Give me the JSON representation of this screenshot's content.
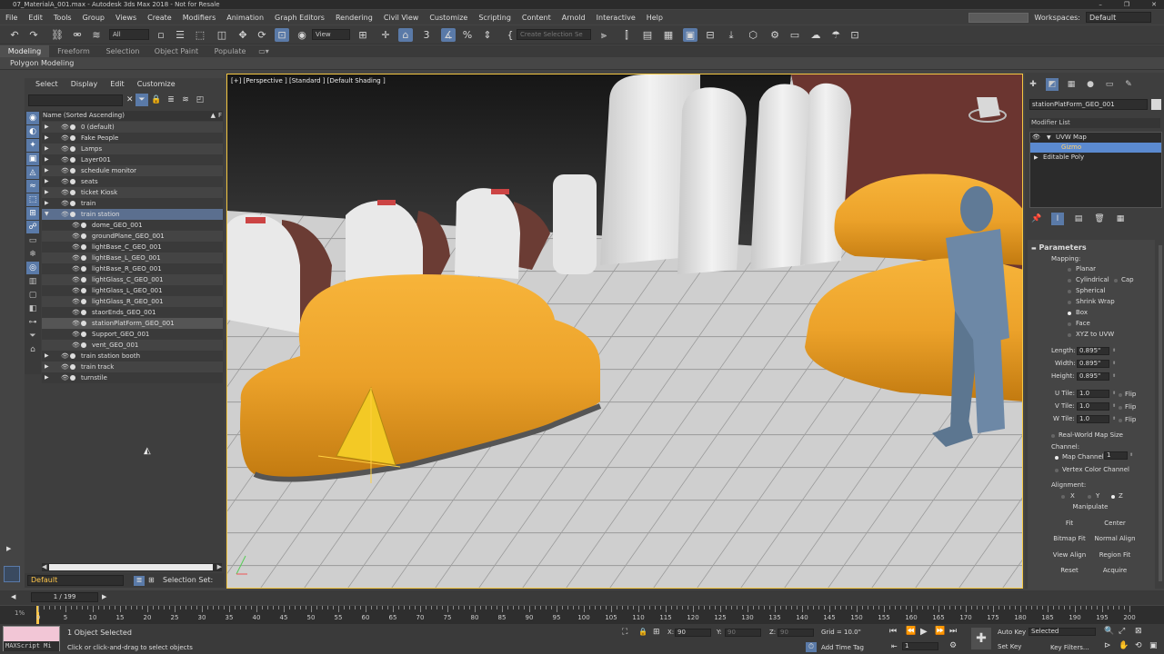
{
  "window": {
    "title": "07_MaterialA_001.max - Autodesk 3ds Max 2018 - Not for Resale"
  },
  "menu": [
    "File",
    "Edit",
    "Tools",
    "Group",
    "Views",
    "Create",
    "Modifiers",
    "Animation",
    "Graph Editors",
    "Rendering",
    "Civil View",
    "Customize",
    "Scripting",
    "Content",
    "Arnold",
    "Interactive",
    "Help"
  ],
  "workspace": {
    "label": "Workspaces:",
    "value": "Default"
  },
  "toolbar": {
    "filter_value": "All",
    "view_value": "View",
    "selection_set_placeholder": "Create Selection Se"
  },
  "ribbon": {
    "tabs": [
      "Modeling",
      "Freeform",
      "Selection",
      "Object Paint",
      "Populate"
    ],
    "subtitle": "Polygon Modeling"
  },
  "explorer": {
    "menu": [
      "Select",
      "Display",
      "Edit",
      "Customize"
    ],
    "header": "Name (Sorted Ascending)",
    "header_s": "▲",
    "header_f": "F",
    "rows": [
      {
        "label": "0 (default)"
      },
      {
        "label": "Fake People"
      },
      {
        "label": "Lamps"
      },
      {
        "label": "Layer001"
      },
      {
        "label": "schedule monitor"
      },
      {
        "label": "seats"
      },
      {
        "label": "ticket Kiosk"
      },
      {
        "label": "train"
      },
      {
        "label": "train station"
      },
      {
        "label": "dome_GEO_001"
      },
      {
        "label": "groundPlane_GEO_001"
      },
      {
        "label": "lightBase_C_GEO_001"
      },
      {
        "label": "lightBase_L_GEO_001"
      },
      {
        "label": "lightBase_R_GEO_001"
      },
      {
        "label": "lightGlass_C_GEO_001"
      },
      {
        "label": "lightGlass_L_GEO_001"
      },
      {
        "label": "lightGlass_R_GEO_001"
      },
      {
        "label": "staorEnds_GEO_001"
      },
      {
        "label": "stationPlatForm_GEO_001"
      },
      {
        "label": "Support_GEO_001"
      },
      {
        "label": "vent_GEO_001"
      },
      {
        "label": "train station booth"
      },
      {
        "label": "train track"
      },
      {
        "label": "turnstile"
      }
    ],
    "layer": "Default",
    "selection_set_label": "Selection Set:"
  },
  "viewport": {
    "label": "[+] [Perspective ] [Standard ] [Default Shading ]"
  },
  "command_panel": {
    "object_name": "stationPlatForm_GEO_001",
    "modifier_list": "Modifier List",
    "stack": [
      "UVW Map",
      "Gizmo",
      "Editable Poly"
    ],
    "parameters": {
      "title": "Parameters",
      "mapping_label": "Mapping:",
      "options": [
        "Planar",
        "Cylindrical",
        "Spherical",
        "Shrink Wrap",
        "Box",
        "Face",
        "XYZ to UVW"
      ],
      "cap": "Cap",
      "length_label": "Length:",
      "length": "0.895\"",
      "width_label": "Width:",
      "width": "0.895\"",
      "height_label": "Height:",
      "height": "0.895\"",
      "utile_label": "U Tile:",
      "utile": "1.0",
      "vtile_label": "V Tile:",
      "vtile": "1.0",
      "wtile_label": "W Tile:",
      "wtile": "1.0",
      "flip": "Flip",
      "real_world": "Real-World Map Size",
      "channel_label": "Channel:",
      "map_channel_label": "Map Channel:",
      "map_channel": "1",
      "vertex_color": "Vertex Color Channel",
      "alignment_label": "Alignment:",
      "axes": [
        "X",
        "Y",
        "Z"
      ],
      "buttons": [
        "Manipulate",
        "Fit",
        "Center",
        "Bitmap Fit",
        "Normal Align",
        "View Align",
        "Region Fit",
        "Reset",
        "Acquire"
      ]
    }
  },
  "timeline": {
    "frame": "1 / 199",
    "percent": "1%",
    "labels": [
      "0",
      "5",
      "10",
      "15",
      "20",
      "25",
      "30",
      "35",
      "40",
      "45",
      "50",
      "55",
      "60",
      "65",
      "70",
      "75",
      "80",
      "85",
      "90",
      "95",
      "100",
      "105",
      "110",
      "115",
      "120",
      "125",
      "130",
      "135",
      "140",
      "145",
      "150",
      "155",
      "160",
      "165",
      "170",
      "175",
      "180",
      "185",
      "190",
      "195",
      "200"
    ]
  },
  "status": {
    "maxscript": "MAXScript Mi",
    "selected": "1 Object Selected",
    "prompt": "Click or click-and-drag to select objects",
    "x_label": "X:",
    "x": "90",
    "y_label": "Y:",
    "y": "90",
    "z_label": "Z:",
    "z": "90",
    "grid": "Grid = 10.0\"",
    "add_time_tag": "Add Time Tag",
    "current_frame": "1",
    "auto_key": "Auto Key",
    "set_key": "Set Key",
    "key_mode": "Selected",
    "key_filters": "Key Filters..."
  }
}
